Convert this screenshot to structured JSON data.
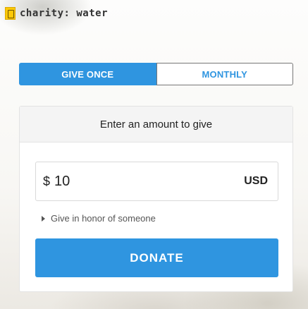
{
  "brand": {
    "name": "charity: water"
  },
  "frequency": {
    "give_once": "GIVE ONCE",
    "monthly": "MONTHLY",
    "selected": "GIVE ONCE"
  },
  "form": {
    "heading": "Enter an amount to give",
    "currency_symbol": "$",
    "amount": "10",
    "currency": "USD",
    "honor_link": "Give in honor of someone",
    "donate_label": "DONATE"
  },
  "colors": {
    "accent": "#2f95e0",
    "brand_yellow": "#ffc907"
  }
}
